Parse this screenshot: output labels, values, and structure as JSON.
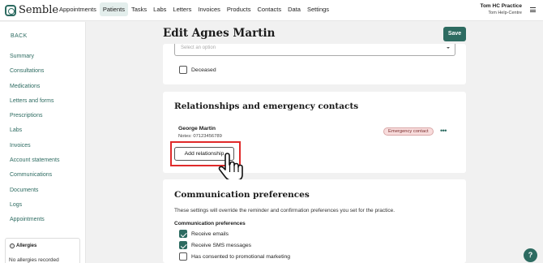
{
  "app": {
    "logo_text": "Semble"
  },
  "nav": {
    "items": [
      "Appointments",
      "Patients",
      "Tasks",
      "Labs",
      "Letters",
      "Invoices",
      "Products",
      "Contacts",
      "Data",
      "Settings"
    ],
    "active": "Patients"
  },
  "user": {
    "practice": "Tom HC Practice",
    "help": "Tom Help-Centre"
  },
  "sidebar": {
    "back": "BACK",
    "items": [
      "Summary",
      "Consultations",
      "Medications",
      "Letters and forms",
      "Prescriptions",
      "Labs",
      "Invoices",
      "Account statements",
      "Communications",
      "Documents",
      "Logs",
      "Appointments"
    ],
    "allergies_title": "Allergies",
    "allergies_text": "No allergies recorded"
  },
  "page": {
    "title": "Edit Agnes Martin",
    "save_label": "Save"
  },
  "details": {
    "select_placeholder": "Select an option",
    "deceased_label": "Deceased"
  },
  "relationships": {
    "title": "Relationships and emergency contacts",
    "contact_name": "George Martin",
    "contact_notes": "Notes:  07123456789",
    "badge": "Emergency contact",
    "add_label": "Add relationship"
  },
  "communication": {
    "title": "Communication preferences",
    "description": "These settings will override the reminder and confirmation preferences you set for the practice.",
    "subtitle": "Communication preferences",
    "options": [
      {
        "label": "Receive emails",
        "checked": true
      },
      {
        "label": "Receive SMS messages",
        "checked": true
      },
      {
        "label": "Has consented to promotional marketing",
        "checked": false
      }
    ]
  },
  "help": {
    "label": "?"
  },
  "colors": {
    "brand": "#2d6b61",
    "highlight": "#e02a2a",
    "badge_bg": "#f8dcdc"
  }
}
